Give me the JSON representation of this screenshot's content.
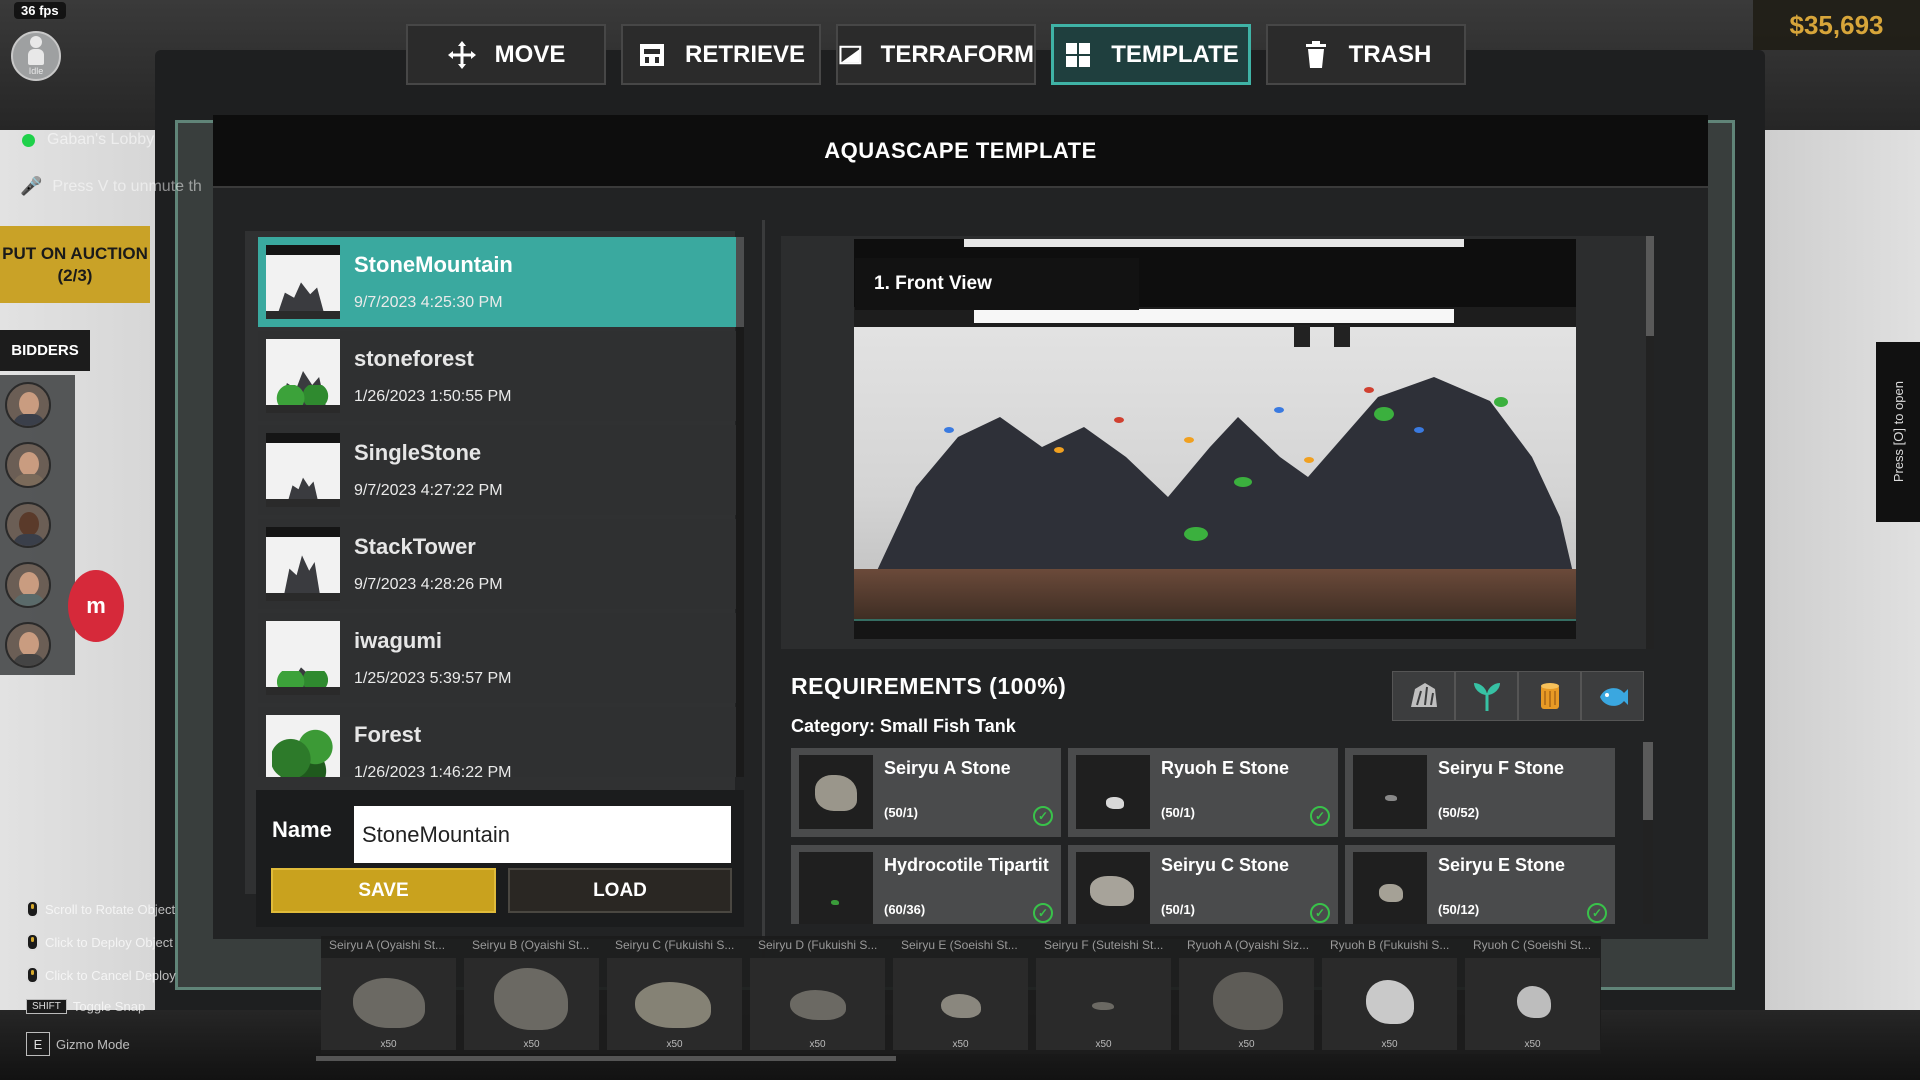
{
  "hud": {
    "fps": "36 fps",
    "idle": "Idle",
    "lobby": "Gaban's Lobby",
    "mute_hint": "Press V to unmute th",
    "auction_button": "PUT ON AUCTION (2/3)",
    "bidders_label": "BIDDERS",
    "rec_badge": "m",
    "money": "$35,693",
    "press_open": "Press [O] to open"
  },
  "toolbar": {
    "tools": [
      {
        "label": "MOVE",
        "icon": "move-arrows-icon"
      },
      {
        "label": "RETRIEVE",
        "icon": "retrieve-box-icon"
      },
      {
        "label": "TERRAFORM",
        "icon": "terraform-icon"
      },
      {
        "label": "TEMPLATE",
        "icon": "template-grid-icon",
        "active": true
      },
      {
        "label": "TRASH",
        "icon": "trash-icon"
      }
    ]
  },
  "panel": {
    "title": "AQUASCAPE TEMPLATE",
    "templates": [
      {
        "name": "StoneMountain",
        "date": "9/7/2023 4:25:30 PM",
        "selected": true
      },
      {
        "name": "stoneforest",
        "date": "1/26/2023 1:50:55 PM"
      },
      {
        "name": "SingleStone",
        "date": "9/7/2023 4:27:22 PM"
      },
      {
        "name": "StackTower",
        "date": "9/7/2023 4:28:26 PM"
      },
      {
        "name": "iwagumi",
        "date": "1/25/2023 5:39:57 PM"
      },
      {
        "name": "Forest",
        "date": "1/26/2023 1:46:22 PM"
      }
    ],
    "name_label": "Name",
    "name_value": "StoneMountain",
    "save_label": "SAVE",
    "load_label": "LOAD",
    "view_label": "1. Front View",
    "requirements_title": "REQUIREMENTS (100%)",
    "category": "Category: Small Fish Tank",
    "filter_icons": [
      "stone-filter-icon",
      "plant-filter-icon",
      "wood-filter-icon",
      "fish-filter-icon"
    ],
    "requirements": [
      {
        "name": "Seiryu A Stone",
        "count": "(50/1)",
        "met": true
      },
      {
        "name": "Ryuoh E Stone",
        "count": "(50/1)",
        "met": true
      },
      {
        "name": "Seiryu F Stone",
        "count": "(50/52)",
        "met": false
      },
      {
        "name": "Hydrocotile Tipartit",
        "count": "(60/36)",
        "met": true
      },
      {
        "name": "Seiryu C Stone",
        "count": "(50/1)",
        "met": true
      },
      {
        "name": "Seiryu E Stone",
        "count": "(50/12)",
        "met": true
      }
    ]
  },
  "inventory": [
    {
      "name": "Seiryu A (Oyaishi St...",
      "qty": "x50"
    },
    {
      "name": "Seiryu B (Oyaishi St...",
      "qty": "x50"
    },
    {
      "name": "Seiryu C (Fukuishi S...",
      "qty": "x50"
    },
    {
      "name": "Seiryu D (Fukuishi S...",
      "qty": "x50"
    },
    {
      "name": "Seiryu E (Soeishi St...",
      "qty": "x50"
    },
    {
      "name": "Seiryu F (Suteishi St...",
      "qty": "x50"
    },
    {
      "name": "Ryuoh A (Oyaishi Siz...",
      "qty": "x50"
    },
    {
      "name": "Ryuoh B (Fukuishi S...",
      "qty": "x50"
    },
    {
      "name": "Ryuoh C (Soeishi St...",
      "qty": "x50"
    }
  ],
  "hints": [
    {
      "text": "Scroll to Rotate Object",
      "key": "mouse"
    },
    {
      "text": "Click to Deploy Object",
      "key": "mouse"
    },
    {
      "text": "Click to Cancel Deploy",
      "key": "mouse"
    },
    {
      "text": "Toggle Snap",
      "key": "SHIFT"
    },
    {
      "text": "Gizmo Mode",
      "key": "E"
    }
  ],
  "colors": {
    "accent_teal": "#3aa99f",
    "save_gold": "#c9a21e",
    "money_gold": "#d7a53a",
    "check_green": "#39c24a"
  }
}
